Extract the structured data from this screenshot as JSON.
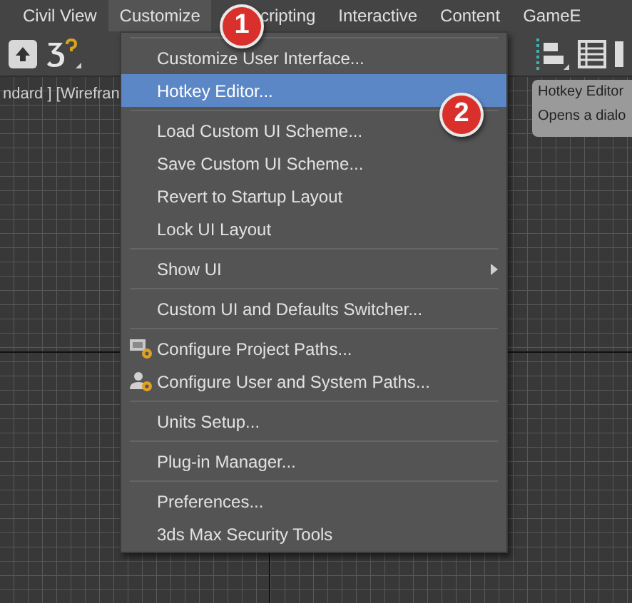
{
  "menu_bar": [
    {
      "label": "Civil View",
      "selected": false
    },
    {
      "label": "Customize",
      "selected": true
    },
    {
      "label": "cripting",
      "selected": false
    },
    {
      "label": "Interactive",
      "selected": false
    },
    {
      "label": "Content",
      "selected": false
    },
    {
      "label": "GameE",
      "selected": false
    }
  ],
  "viewport": {
    "label": "ndard ] [Wirefran"
  },
  "menu": [
    {
      "kind": "separator"
    },
    {
      "kind": "item",
      "label": "Customize User Interface...",
      "selected": false
    },
    {
      "kind": "item",
      "label": "Hotkey Editor...",
      "selected": true
    },
    {
      "kind": "separator"
    },
    {
      "kind": "item",
      "label": "Load Custom UI Scheme...",
      "selected": false
    },
    {
      "kind": "item",
      "label": "Save Custom UI Scheme...",
      "selected": false
    },
    {
      "kind": "item",
      "label": "Revert to Startup Layout",
      "selected": false
    },
    {
      "kind": "item",
      "label": "Lock UI Layout",
      "selected": false
    },
    {
      "kind": "separator"
    },
    {
      "kind": "submenu",
      "label": "Show UI",
      "selected": false
    },
    {
      "kind": "separator"
    },
    {
      "kind": "item",
      "label": "Custom UI and Defaults Switcher...",
      "selected": false
    },
    {
      "kind": "separator"
    },
    {
      "kind": "project_paths",
      "label": "Configure Project Paths...",
      "selected": false
    },
    {
      "kind": "user_paths",
      "label": "Configure User and System Paths...",
      "selected": false
    },
    {
      "kind": "separator"
    },
    {
      "kind": "item",
      "label": "Units Setup...",
      "selected": false
    },
    {
      "kind": "separator"
    },
    {
      "kind": "item",
      "label": "Plug-in Manager...",
      "selected": false
    },
    {
      "kind": "separator"
    },
    {
      "kind": "item",
      "label": "Preferences...",
      "selected": false
    },
    {
      "kind": "item",
      "label": "3ds Max Security Tools",
      "selected": false
    }
  ],
  "tooltip": {
    "title": "Hotkey Editor",
    "description": "Opens a dialo"
  },
  "callouts": [
    {
      "number": "1"
    },
    {
      "number": "2"
    }
  ]
}
